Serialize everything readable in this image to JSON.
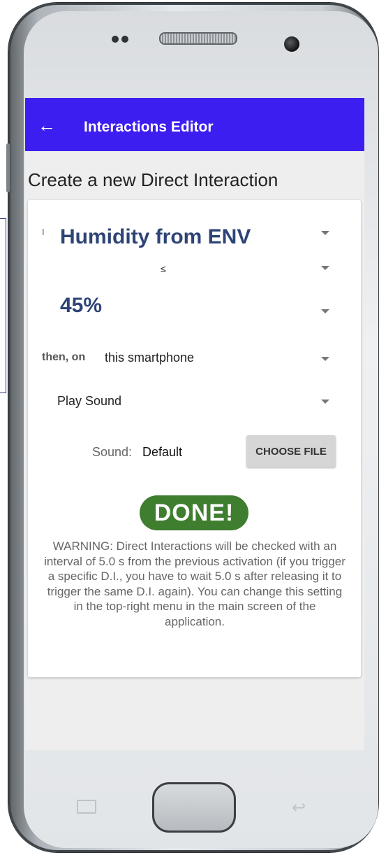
{
  "appbar": {
    "back_icon": "arrow-back-icon",
    "title": "Interactions Editor"
  },
  "page": {
    "heading": "Create a new Direct Interaction"
  },
  "form": {
    "sensor_prefix": "I",
    "sensor_value": "Humidity from ENV",
    "comparator": "≤",
    "threshold_value": "45%",
    "then_label": "then, on",
    "device_value": "this smartphone",
    "action_value": "Play Sound",
    "sound_label": "Sound:",
    "sound_value": "Default",
    "choose_file_label": "CHOOSE FILE",
    "done_label": "DONE!",
    "warning_text": "WARNING: Direct Interactions will be checked with an interval of 5.0 s from the previous activation (if you trigger a specific D.I., you have to wait 5.0 s after releasing it to trigger the same D.I. again). You can change this setting in the top-right menu in the main screen of the application."
  },
  "colors": {
    "appbar": "#3d1ef0",
    "label_text": "#2e4476",
    "done_button": "#3f7d2f"
  }
}
